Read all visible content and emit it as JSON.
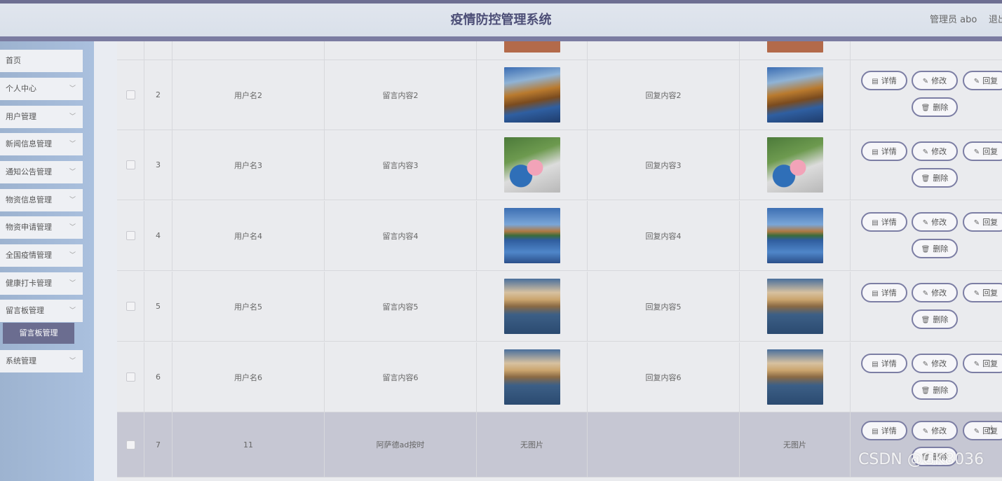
{
  "header": {
    "title": "疫情防控管理系统",
    "user": "管理员 abo",
    "logout": "退出"
  },
  "sidebar": {
    "items": [
      {
        "label": "首页",
        "expandable": false
      },
      {
        "label": "个人中心",
        "expandable": true
      },
      {
        "label": "用户管理",
        "expandable": true
      },
      {
        "label": "新闻信息管理",
        "expandable": true
      },
      {
        "label": "通知公告管理",
        "expandable": true
      },
      {
        "label": "物资信息管理",
        "expandable": true
      },
      {
        "label": "物资申请管理",
        "expandable": true
      },
      {
        "label": "全国疫情管理",
        "expandable": true
      },
      {
        "label": "健康打卡管理",
        "expandable": true
      },
      {
        "label": "留言板管理",
        "expandable": true
      },
      {
        "label": "系统管理",
        "expandable": true
      }
    ],
    "submenu": {
      "label": "留言板管理"
    }
  },
  "table": {
    "rows": [
      {
        "index": "2",
        "username": "用户名2",
        "message": "留言内容2",
        "image": "road",
        "reply": "回复内容2",
        "reply_image": "road"
      },
      {
        "index": "3",
        "username": "用户名3",
        "message": "留言内容3",
        "image": "flowers",
        "reply": "回复内容3",
        "reply_image": "flowers"
      },
      {
        "index": "4",
        "username": "用户名4",
        "message": "留言内容4",
        "image": "lake",
        "reply": "回复内容4",
        "reply_image": "lake"
      },
      {
        "index": "5",
        "username": "用户名5",
        "message": "留言内容5",
        "image": "village",
        "reply": "回复内容5",
        "reply_image": "village"
      },
      {
        "index": "6",
        "username": "用户名6",
        "message": "留言内容6",
        "image": "village",
        "reply": "回复内容6",
        "reply_image": "village"
      },
      {
        "index": "7",
        "username": "11",
        "message": "阿萨德ad按时",
        "image_text": "无图片",
        "reply": "",
        "reply_image_text": "无图片"
      }
    ],
    "actions": {
      "detail": "详情",
      "edit": "修改",
      "reply": "回复",
      "delete": "删除"
    }
  },
  "watermark": "CSDN @GK8036",
  "colors": {
    "accent": "#6e6f92",
    "header_bg": "#dde3ec",
    "sidebar_bg": "#a6bcda",
    "highlight_row": "#c6c7d3"
  }
}
